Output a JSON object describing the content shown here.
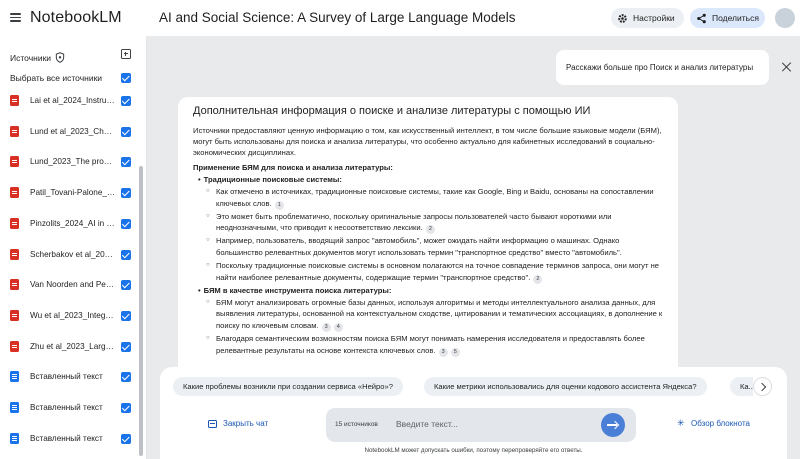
{
  "header": {
    "brand": "NotebookLM",
    "notebook_title": "AI and Social Science: A Survey of Large Language Models",
    "settings_label": "Настройки",
    "share_label": "Поделиться"
  },
  "sidebar": {
    "title": "Источники",
    "select_all_label": "Выбрать все источники",
    "sources": [
      {
        "label": "Lai et al_2024_Instructi...",
        "type": "pdf",
        "checked": true
      },
      {
        "label": "Lund et al_2023_Chatgp...",
        "type": "pdf",
        "checked": true
      },
      {
        "label": "Lund_2023_The promis...",
        "type": "pdf",
        "checked": true
      },
      {
        "label": "Patil_Tovani-Palone_20...",
        "type": "pdf",
        "checked": true
      },
      {
        "label": "Pinzolits_2024_AI in acad...",
        "type": "pdf",
        "checked": true
      },
      {
        "label": "Scherbakov et al_2024...",
        "type": "pdf",
        "checked": true
      },
      {
        "label": "Van Noorden and Perkel_...",
        "type": "pdf",
        "checked": true
      },
      {
        "label": "Wu et al_2023_Integrati...",
        "type": "pdf",
        "checked": true
      },
      {
        "label": "Zhu et al_2023_Large la...",
        "type": "pdf",
        "checked": true
      },
      {
        "label": "Вставленный текст",
        "type": "text",
        "checked": true
      },
      {
        "label": "Вставленный текст",
        "type": "text",
        "checked": true
      },
      {
        "label": "Вставленный текст",
        "type": "text",
        "checked": true
      }
    ]
  },
  "chat": {
    "user_message": "Расскажи больше про Поиск и анализ литературы",
    "answer": {
      "title": "Дополнительная информация о поиске и анализе литературы с помощью ИИ",
      "intro": "Источники предоставляют ценную информацию о том, как искусственный интеллект, в том числе большие языковые модели (БЯМ), могут быть использованы для поиска и анализа литературы, что особенно актуально для кабинетных исследований в социально-экономических дисциплинах.",
      "heading": "Применение БЯМ для поиска и анализа литературы:",
      "sections": [
        {
          "title": "Традиционные поисковые системы:",
          "items": [
            {
              "text": "Как отмечено в источниках, традиционные поисковые системы, такие как Google, Bing и Baidu, основаны на сопоставлении ключевых слов.",
              "cites": [
                "1"
              ]
            },
            {
              "text": "Это может быть проблематично, поскольку оригинальные запросы пользователей часто бывают короткими или неоднозначными, что приводит к несоответствию лексики.",
              "cites": [
                "2"
              ]
            },
            {
              "text": "Например, пользователь, вводящий запрос \"автомобиль\", может ожидать найти информацию о машинах. Однако большинство релевантных документов могут использовать термин \"транспортное средство\" вместо \"автомобиль\".",
              "cites": []
            },
            {
              "text": "Поскольку традиционные поисковые системы в основном полагаются на точное совпадение терминов запроса, они могут не найти наиболее релевантные документы, содержащие термин \"транспортное средство\".",
              "cites": [
                "2"
              ]
            }
          ]
        },
        {
          "title": "БЯМ в качестве инструмента поиска литературы:",
          "items": [
            {
              "text": "БЯМ могут анализировать огромные базы данных, используя алгоритмы и методы интеллектуального анализа данных, для выявления литературы, основанной на контекстуальном сходстве, цитировании и тематических ассоциациях, в дополнение к поиску по ключевым словам.",
              "cites": [
                "3",
                "4"
              ]
            },
            {
              "text": "Благодаря семантическим возможностям поиска БЯМ могут понимать намерения исследователя и предоставлять более релевантные результаты на основе контекста ключевых слов.",
              "cites": [
                "3",
                "5"
              ]
            }
          ]
        }
      ]
    },
    "suggestions": [
      "Какие проблемы возникли при создании сервиса «Нейро»?",
      "Какие метрики использовались для оценки кодового ассистента Яндекса?",
      "Ка..."
    ],
    "close_chat_label": "Закрыть чат",
    "source_count": "15 источников",
    "input_placeholder": "Введите текст...",
    "overview_label": "Обзор блокнота",
    "disclaimer": "NotebookLM может допускать ошибки, поэтому перепроверяйте его ответы."
  },
  "colors": {
    "accent": "#1a73e8",
    "pdf_icon": "#d93025",
    "share_bg": "#dbe7fb",
    "send_button": "#4a7fd8"
  }
}
